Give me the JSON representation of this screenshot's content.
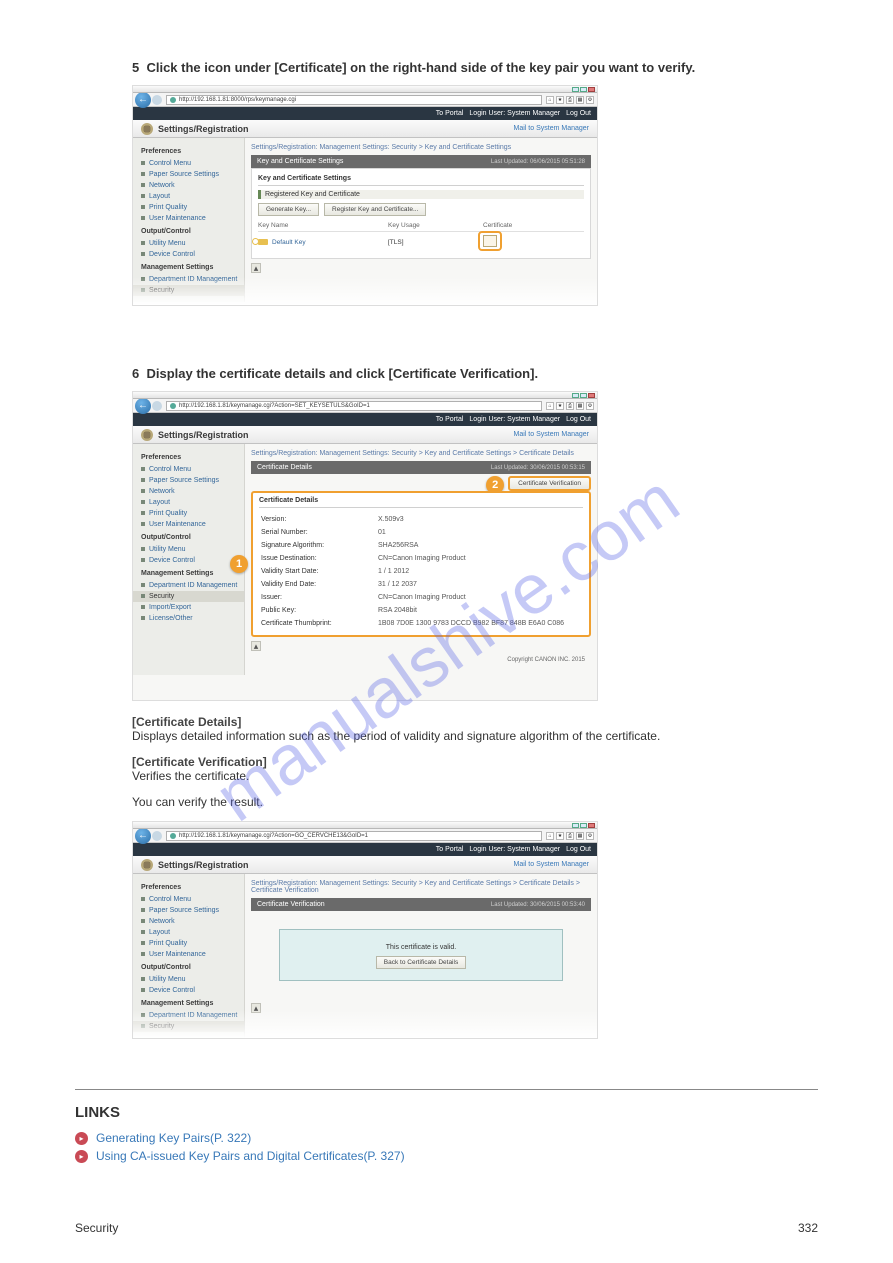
{
  "watermark": "manualshive.com",
  "step5": {
    "num": "5",
    "text": "Click the icon under [Certificate] on the right-hand side of the key pair you want to verify."
  },
  "step6": {
    "num": "6",
    "body1": "Display the certificate details and click [Certificate Verification].",
    "caption_badge1": "[Certificate Details]",
    "caption_text1": "Displays detailed information such as the period of validity and signature algorithm of the certificate.",
    "caption_badge2": "[Certificate Verification]",
    "caption_text2": "Verifies the certificate."
  },
  "result_caption": "You can verify the result.",
  "common_ui": {
    "toportal": "To Portal",
    "loginuser": "Login User:",
    "sysmgr": "System Manager",
    "logout": "Log Out",
    "title": "Settings/Registration",
    "mail": "Mail to System Manager",
    "sidebar": {
      "pref": "Preferences",
      "items1": [
        "Control Menu",
        "Paper Source Settings",
        "Network",
        "Layout",
        "Print Quality",
        "User Maintenance"
      ],
      "out": "Output/Control",
      "items2": [
        "Utility Menu",
        "Device Control"
      ],
      "mgmt": "Management Settings",
      "items3": [
        "Department ID Management",
        "Security",
        "Import/Export",
        "License/Other"
      ]
    }
  },
  "shot1": {
    "url": "http://192.168.1.81:8000/rps/keymanage.cgi",
    "breadcrumb": "Settings/Registration: Management Settings: Security > Key and Certificate Settings",
    "panel_title": "Key and Certificate Settings",
    "updated": "Last Updated: 06/06/2015 05:51:28",
    "subhead": "Key and Certificate Settings",
    "innerhead": "Registered Key and Certificate",
    "btn1": "Generate Key...",
    "btn2": "Register Key and Certificate...",
    "th1": "Key Name",
    "th2": "Key Usage",
    "th3": "Certificate",
    "row_key": "Default Key",
    "row_usage": "[TLS]"
  },
  "shot2": {
    "url": "http://192.168.1.81/keymanage.cgi?Action=SET_KEYSETULS&GoID=1",
    "breadcrumb": "Settings/Registration: Management Settings: Security > Key and Certificate Settings > Certificate Details",
    "panel_title": "Certificate Details",
    "updated": "Last Updated: 30/06/2015 00:53:15",
    "verify_btn": "Certificate Verification",
    "section": "Certificate Details",
    "rows": [
      [
        "Version:",
        "X.509v3"
      ],
      [
        "Serial Number:",
        "01"
      ],
      [
        "Signature Algorithm:",
        "SHA256RSA"
      ],
      [
        "Issue Destination:",
        "CN=Canon Imaging Product"
      ],
      [
        "Validity Start Date:",
        "1 / 1 2012"
      ],
      [
        "Validity End Date:",
        "31 / 12 2037"
      ],
      [
        "Issuer:",
        "CN=Canon Imaging Product"
      ],
      [
        "Public Key:",
        "RSA 2048bit"
      ],
      [
        "Certificate Thumbprint:",
        "1B08 7D0E 1300 9783 DCCD B982 BF87 848B E6A0 C086"
      ]
    ],
    "copyright": "Copyright CANON INC. 2015"
  },
  "shot3": {
    "url": "http://192.168.1.81/keymanage.cgi?Action=GO_CERVCHE13&GoID=1",
    "breadcrumb": "Settings/Registration: Management Settings: Security > Key and Certificate Settings > Certificate Details > Certificate Verification",
    "panel_title": "Certificate Verification",
    "updated": "Last Updated: 30/06/2015 00:53:40",
    "valid_msg": "This certificate is valid.",
    "back_btn": "Back to Certificate Details"
  },
  "links": {
    "head": "LINKS",
    "l1": "Generating Key Pairs(P. 322)",
    "l2": "Using CA-issued Key Pairs and Digital Certificates(P. 327)"
  },
  "footer": {
    "section": "Security",
    "page": "332"
  }
}
